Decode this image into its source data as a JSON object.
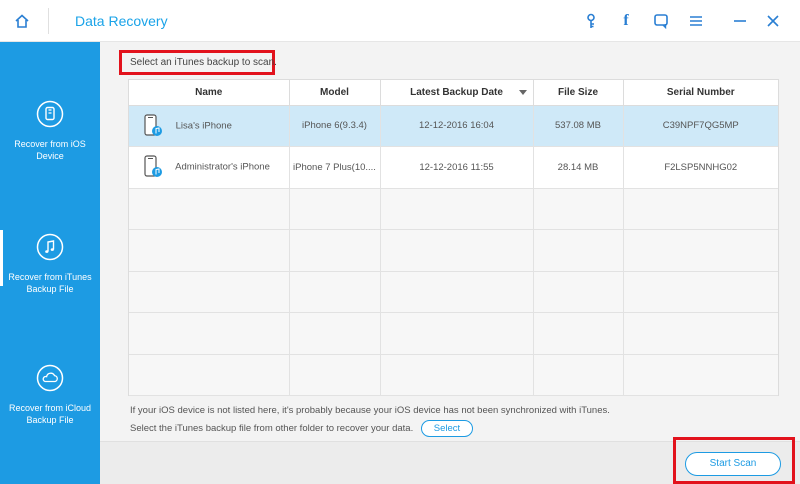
{
  "window": {
    "title": "Data Recovery"
  },
  "toolbar": {
    "icons": [
      "home-icon",
      "key-icon",
      "facebook-icon",
      "feedback-icon",
      "menu-icon",
      "minimize-icon",
      "close-icon"
    ],
    "facebook_glyph": "f"
  },
  "sidebar": {
    "items": [
      {
        "label": "Recover from iOS Device",
        "icon": "ios-device-icon"
      },
      {
        "label": "Recover from iTunes Backup File",
        "icon": "itunes-icon"
      },
      {
        "label": "Recover from iCloud Backup File",
        "icon": "icloud-icon"
      }
    ],
    "active": "Recover from iTunes Backup File"
  },
  "main": {
    "instruction": "Select an iTunes backup to scan.",
    "table": {
      "headers": [
        "Name",
        "Model",
        "Latest Backup Date",
        "File Size",
        "Serial Number"
      ],
      "rows": [
        {
          "name": "Lisa's iPhone",
          "model": "iPhone 6(9.3.4)",
          "date": "12-12-2016 16:04",
          "size": "537.08 MB",
          "serial": "C39NPF7QG5MP"
        },
        {
          "name": "Administrator's iPhone",
          "model": "iPhone 7 Plus(10....",
          "date": "12-12-2016 11:55",
          "size": "28.14 MB",
          "serial": "F2LSP5NNHG02"
        }
      ],
      "selected_row": 0
    },
    "note_line1": "If your iOS device is not listed here, it's probably because your iOS device has not been synchronized with iTunes.",
    "note_line2": "Select the iTunes backup file from other folder to recover your data.",
    "select_button": "Select",
    "start_scan_button": "Start Scan"
  },
  "colors": {
    "accent": "#1d9be3",
    "highlight": "#e2121c",
    "selected_row": "#cfe9f8"
  }
}
